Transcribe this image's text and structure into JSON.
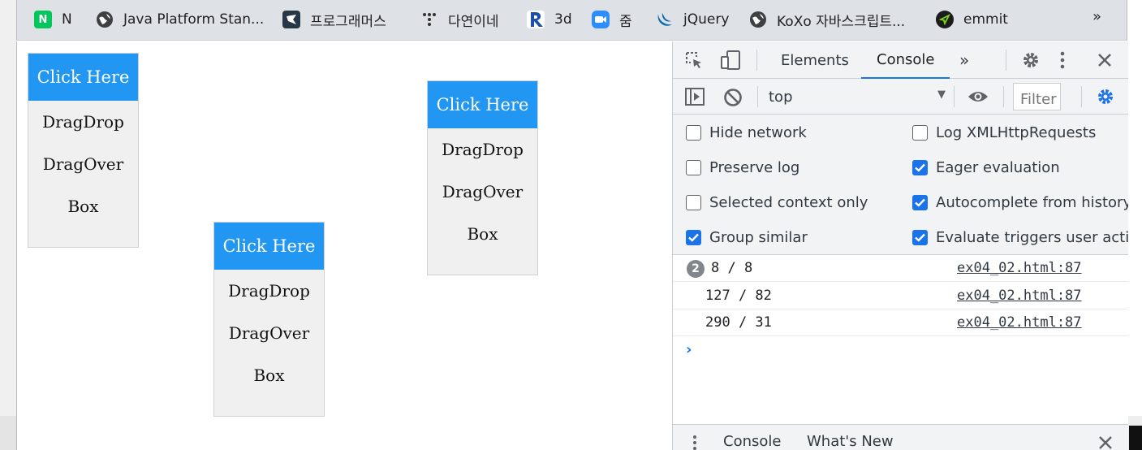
{
  "bookmarks": [
    {
      "icon": "naver-icon",
      "label": "N",
      "color": "#03c75a"
    },
    {
      "icon": "globe-icon",
      "label": "Java Platform Stan..."
    },
    {
      "icon": "programmers-icon",
      "label": "프로그래머스",
      "color": "#263747"
    },
    {
      "icon": "dots-icon",
      "label": "다연이네"
    },
    {
      "icon": "r-logo-icon",
      "label": "3d",
      "color": "#1e4fa8"
    },
    {
      "icon": "zoom-icon",
      "label": "줌",
      "color": "#2d8cff"
    },
    {
      "icon": "jquery-icon",
      "label": "jQuery",
      "color": "#0769ad"
    },
    {
      "icon": "globe-icon",
      "label": "KoXo 자바스크립트..."
    },
    {
      "icon": "emmet-icon",
      "label": "emmit",
      "color": "#1c1c1c"
    }
  ],
  "bookmarks_more": "»",
  "boxes": [
    {
      "header": "Click Here",
      "lines": [
        "DragDrop",
        "DragOver",
        "Box"
      ]
    },
    {
      "header": "Click Here",
      "lines": [
        "DragDrop",
        "DragOver",
        "Box"
      ]
    },
    {
      "header": "Click Here",
      "lines": [
        "DragDrop",
        "DragOver",
        "Box"
      ]
    }
  ],
  "devtools": {
    "tabs": {
      "elements": "Elements",
      "console": "Console",
      "more": "»"
    },
    "context": "top",
    "filter_placeholder": "Filter",
    "options": {
      "hide_network": {
        "label": "Hide network",
        "checked": false
      },
      "preserve_log": {
        "label": "Preserve log",
        "checked": false
      },
      "selected_context": {
        "label": "Selected context only",
        "checked": false
      },
      "group_similar": {
        "label": "Group similar",
        "checked": true
      },
      "log_xhr": {
        "label": "Log XMLHttpRequests",
        "checked": false
      },
      "eager_eval": {
        "label": "Eager evaluation",
        "checked": true
      },
      "autocomplete": {
        "label": "Autocomplete from history",
        "checked": true
      },
      "evaluate_triggers": {
        "label": "Evaluate triggers user activation",
        "checked": true
      }
    },
    "logs": [
      {
        "count": "2",
        "message": "8 / 8",
        "source": "ex04_02.html:87"
      },
      {
        "message": "127 / 82",
        "source": "ex04_02.html:87"
      },
      {
        "message": "290 / 31",
        "source": "ex04_02.html:87"
      }
    ],
    "prompt": "›",
    "drawer": {
      "console": "Console",
      "whats_new": "What's New"
    }
  },
  "colors": {
    "accent": "#1a73e8",
    "box_header": "#2196f3",
    "box_body": "#f0f0f0"
  }
}
